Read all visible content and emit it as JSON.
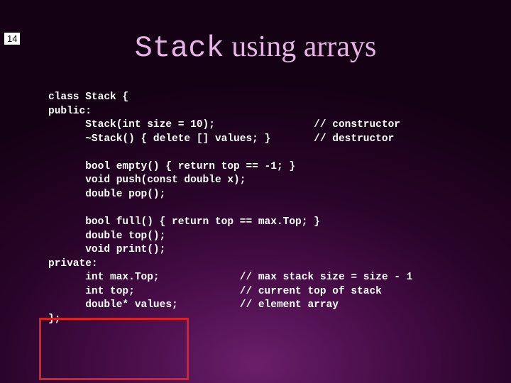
{
  "page_number": "14",
  "title": {
    "mono": "Stack",
    "rest": " using arrays"
  },
  "code": {
    "l1": "class Stack {",
    "l2": "public:",
    "l3": "      Stack(int size = 10);                // constructor",
    "l4": "      ~Stack() { delete [] values; }       // destructor",
    "l5": "",
    "l6": "      bool empty() { return top == -1; }",
    "l7": "      void push(const double x);",
    "l8": "      double pop();",
    "l9": "",
    "l10": "      bool full() { return top == max.Top; }",
    "l11": "      double top();",
    "l12": "      void print();",
    "l13": "private:",
    "l14": "      int max.Top;             // max stack size = size - 1",
    "l15": "      int top;                 // current top of stack",
    "l16": "      double* values;          // element array",
    "l17": "};"
  }
}
